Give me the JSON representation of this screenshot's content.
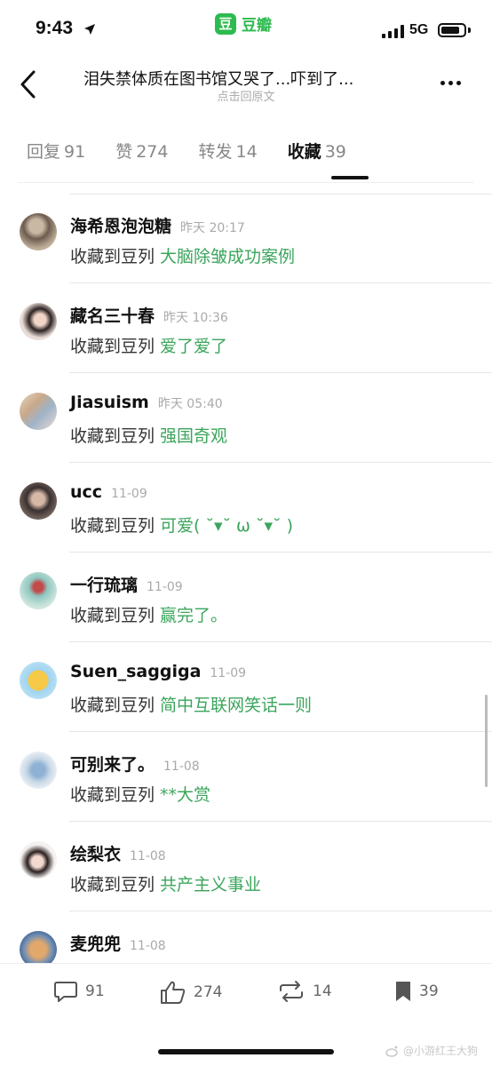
{
  "status_bar": {
    "time": "9:43",
    "network": "5G",
    "brand_logo": "豆",
    "brand_name": "豆瓣",
    "battery_level": 0.85
  },
  "nav": {
    "title": "泪失禁体质在图书馆又哭了...吓到了...",
    "subtitle": "点击回原文"
  },
  "tabs": [
    {
      "label": "回复",
      "count": "91"
    },
    {
      "label": "赞",
      "count": "274"
    },
    {
      "label": "转发",
      "count": "14"
    },
    {
      "label": "收藏",
      "count": "39",
      "active": true
    }
  ],
  "items": [
    {
      "name": "海希恩泡泡糖",
      "time": "昨天 20:17",
      "prefix": "收藏到豆列",
      "doulist": "大脑除皱成功案例"
    },
    {
      "name": "藏名三十春",
      "time": "昨天 10:36",
      "prefix": "收藏到豆列",
      "doulist": "爱了爱了"
    },
    {
      "name": "Jiasuism",
      "time": "昨天 05:40",
      "prefix": "收藏到豆列",
      "doulist": "强国奇观"
    },
    {
      "name": "ucc",
      "time": "11-09",
      "prefix": "收藏到豆列",
      "doulist": "可爱( ˘▾˘ ω ˘▾˘ )"
    },
    {
      "name": "一行琉璃",
      "time": "11-09",
      "prefix": "收藏到豆列",
      "doulist": "赢完了。"
    },
    {
      "name": "Suen_saggiga",
      "time": "11-09",
      "prefix": "收藏到豆列",
      "doulist": "简中互联网笑话一则"
    },
    {
      "name": "可别来了。",
      "time": "11-08",
      "prefix": "收藏到豆列",
      "doulist": "**大赏"
    },
    {
      "name": "绘梨衣",
      "time": "11-08",
      "prefix": "收藏到豆列",
      "doulist": "共产主义事业"
    },
    {
      "name": "麦兜兜",
      "time": "11-08",
      "prefix": "",
      "doulist": ""
    }
  ],
  "bottom_bar": {
    "replies": "91",
    "likes": "274",
    "reshares": "14",
    "collects": "39"
  },
  "watermark": "@小游红王大狗",
  "colors": {
    "accent_green": "#3ba55c",
    "brand_green": "#2dbb4f"
  },
  "icons": [
    "location-arrow-icon",
    "signal-icon",
    "battery-icon",
    "back-chevron-icon",
    "more-dots-icon",
    "comment-icon",
    "thumbs-up-icon",
    "reshare-icon",
    "bookmark-icon",
    "weibo-icon"
  ]
}
